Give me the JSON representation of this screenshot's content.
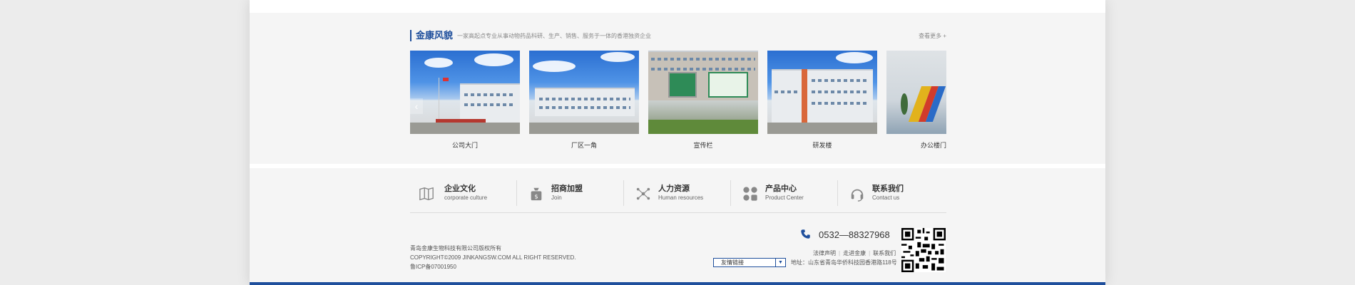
{
  "gallery": {
    "title": "金康风貌",
    "subtitle": "一家高起点专业从事动物药品科研、生产、销售、服务于一体的香港独资企业",
    "more_label": "查看更多 +",
    "prev_arrow": "‹",
    "items": [
      {
        "caption": "公司大门"
      },
      {
        "caption": "厂区一角"
      },
      {
        "caption": "宣传栏"
      },
      {
        "caption": "研发楼"
      },
      {
        "caption": "办公楼门"
      }
    ]
  },
  "footer_nav": [
    {
      "title": "企业文化",
      "sub": "corporate culture",
      "icon": "book-icon"
    },
    {
      "title": "招商加盟",
      "sub": "Join",
      "icon": "money-bag-icon"
    },
    {
      "title": "人力资源",
      "sub": "Human resources",
      "icon": "network-icon"
    },
    {
      "title": "产品中心",
      "sub": "Product Center",
      "icon": "grid-icon"
    },
    {
      "title": "联系我们",
      "sub": "Contact us",
      "icon": "headset-icon"
    }
  ],
  "copyright": {
    "line1": "青岛金康生物科技有限公司版权所有",
    "line2": "COPYRIGHT©2009 JINKANGSW.COM ALL RIGHT RESERVED.",
    "line3": "鲁ICP备07001950"
  },
  "contact": {
    "phone": "0532—88327968",
    "links": [
      "法律声明",
      "走进金康",
      "联系我们"
    ],
    "address": "地址：山东省青岛华侨科技园香港路118号"
  },
  "friend_links_select": "友情链接",
  "colors": {
    "accent": "#1f4f9c",
    "background": "#f5f5f5"
  }
}
